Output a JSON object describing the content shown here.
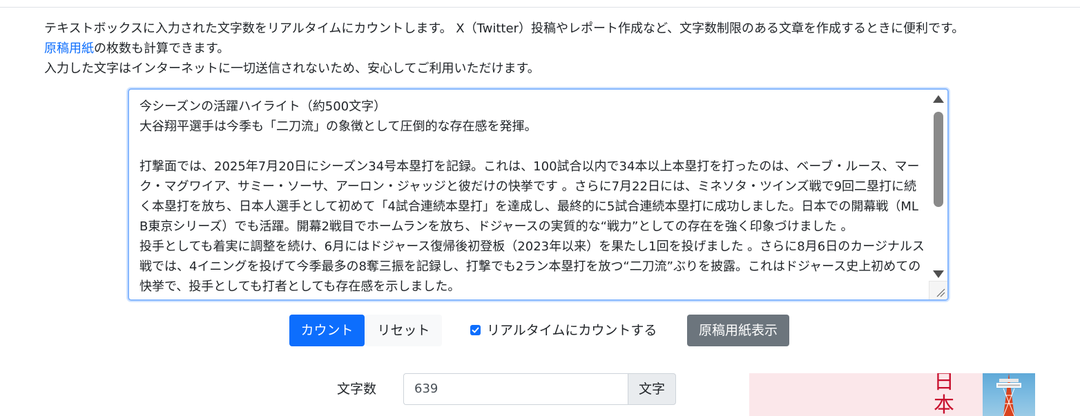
{
  "intro": {
    "line1": "テキストボックスに入力された文字数をリアルタイムにカウントします。 X（Twitter）投稿やレポート作成など、文字数制限のある文章を作成するときに便利です。",
    "link": "原稿用紙",
    "line2_rest": "の枚数も計算できます。",
    "line3": "入力した文字はインターネットに一切送信されないため、安心してご利用いただけます。"
  },
  "textarea": {
    "value": "今シーズンの活躍ハイライト（約500文字）\n大谷翔平選手は今季も「二刀流」の象徴として圧倒的な存在感を発揮。\n\n打撃面では、2025年7月20日にシーズン34号本塁打を記録。これは、100試合以内で34本以上本塁打を打ったのは、ベーブ・ルース、マーク・マグワイア、サミー・ソーサ、アーロン・ジャッジと彼だけの快挙です 。さらに7月22日には、ミネソタ・ツインズ戦で9回二塁打に続く本塁打を放ち、日本人選手として初めて「4試合連続本塁打」を達成し、最終的に5試合連続本塁打に成功しました。日本での開幕戦（MLB東京シリーズ）でも活躍。開幕2戦目でホームランを放ち、ドジャースの実質的な“戦力”としての存在を強く印象づけました 。\n投手としても着実に調整を続け、6月にはドジャース復帰後初登板（2023年以来）を果たし1回を投げました 。さらに8月6日のカージナルス戦では、4イニングを投げて今季最多の8奪三振を記録し、打撃でも2ラン本塁打を放つ“二刀流”ぶりを披露。これはドジャース史上初めての快挙で、投手としても打者としても存在感を示しました。"
  },
  "buttons": {
    "count": "カウント",
    "reset": "リセット",
    "realtime": "リアルタイムにカウントする",
    "realtime_checked": true,
    "genko": "原稿用紙表示"
  },
  "count": {
    "label": "文字数",
    "value": "639",
    "unit": "文字"
  },
  "ad": {
    "text": "日\n本"
  },
  "colors": {
    "primary": "#0d6efd",
    "secondary": "#6c757d",
    "focus_border": "#86b7fe",
    "ad_red": "#c8102e"
  }
}
